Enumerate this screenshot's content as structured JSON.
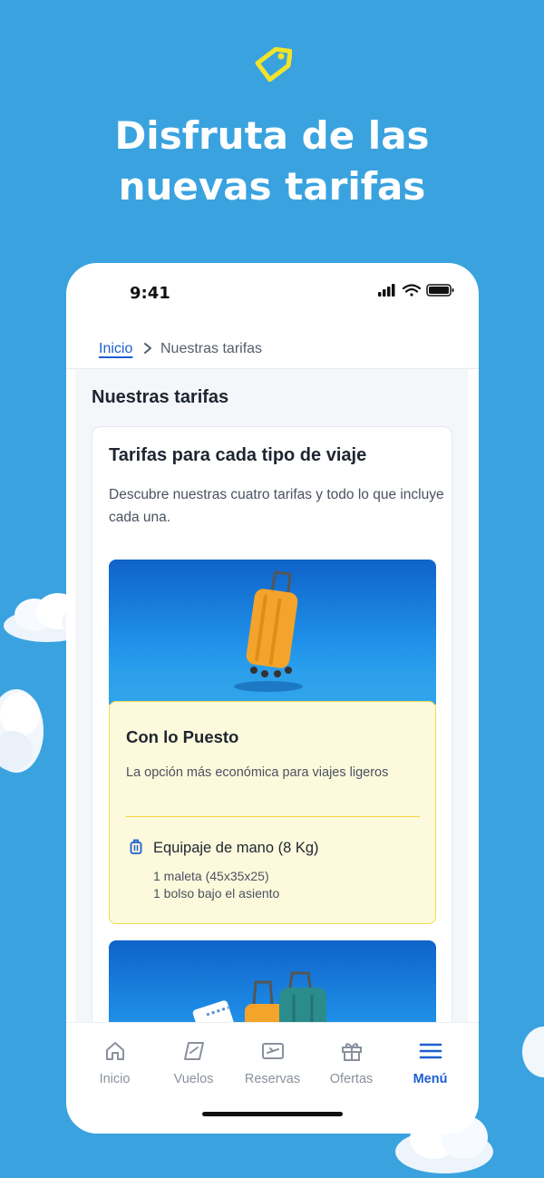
{
  "promo": {
    "icon": "tag-icon",
    "headline_line1": "Disfruta de las",
    "headline_line2": "nuevas tarifas"
  },
  "status_bar": {
    "time": "9:41"
  },
  "breadcrumb": {
    "home": "Inicio",
    "current": "Nuestras tarifas"
  },
  "page": {
    "title": "Nuestras tarifas",
    "card_title": "Tarifas para cada tipo de viaje",
    "card_description": "Descubre nuestras cuatro tarifas y todo lo que incluye cada una."
  },
  "fares": [
    {
      "name": "Con lo Puesto",
      "description": "La opción más económica para viajes ligeros",
      "item_title": "Equipaje de mano (8 Kg)",
      "item_detail1": "1 maleta (45x35x25)",
      "item_detail2": "1 bolso bajo el asiento"
    }
  ],
  "tabbar": {
    "items": [
      {
        "label": "Inicio",
        "icon": "home-icon",
        "active": false
      },
      {
        "label": "Vuelos",
        "icon": "plane-ticket-icon",
        "active": false
      },
      {
        "label": "Reservas",
        "icon": "boarding-pass-icon",
        "active": false
      },
      {
        "label": "Ofertas",
        "icon": "gift-icon",
        "active": false
      },
      {
        "label": "Menú",
        "icon": "menu-icon",
        "active": true
      }
    ]
  },
  "colors": {
    "background": "#3aa3df",
    "accent": "#1d5fd0",
    "fare_highlight": "#fdf9dc",
    "fare_border": "#f2dd4b",
    "tag_icon": "#f3e32a"
  }
}
